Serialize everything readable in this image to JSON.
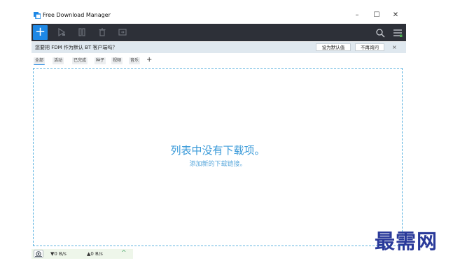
{
  "window": {
    "title": "Free Download Manager",
    "controls": {
      "minimize": "–",
      "maximize": "☐",
      "close": "✕"
    }
  },
  "toolbar": {
    "add_label": "+",
    "icons": [
      "add-icon",
      "play-icon",
      "pause-icon",
      "delete-icon",
      "folder-icon",
      "search-icon",
      "menu-icon"
    ]
  },
  "notification": {
    "text": "您要把 FDM 作为默认 BT 客户端吗？",
    "set_default": "设为默认值",
    "dont_ask": "不再询问",
    "close": "×"
  },
  "filters": {
    "tabs": [
      {
        "label": "全部"
      },
      {
        "label": "活动"
      },
      {
        "label": "已完成"
      },
      {
        "label": "种子"
      },
      {
        "label": "视频"
      },
      {
        "label": "音乐"
      }
    ],
    "add": "+"
  },
  "main": {
    "empty_title": "列表中没有下载项。",
    "empty_subtitle": "添加新的下载链接。"
  },
  "status": {
    "download_speed": "▼0 B/s",
    "upload_speed": "▲0 B/s",
    "expand": "^"
  },
  "watermark": "最需网",
  "colors": {
    "accent": "#1e88e5",
    "toolbar_bg": "#2d3038",
    "dropzone_border": "#5fb4e0",
    "status_bg": "#eef6ea"
  }
}
